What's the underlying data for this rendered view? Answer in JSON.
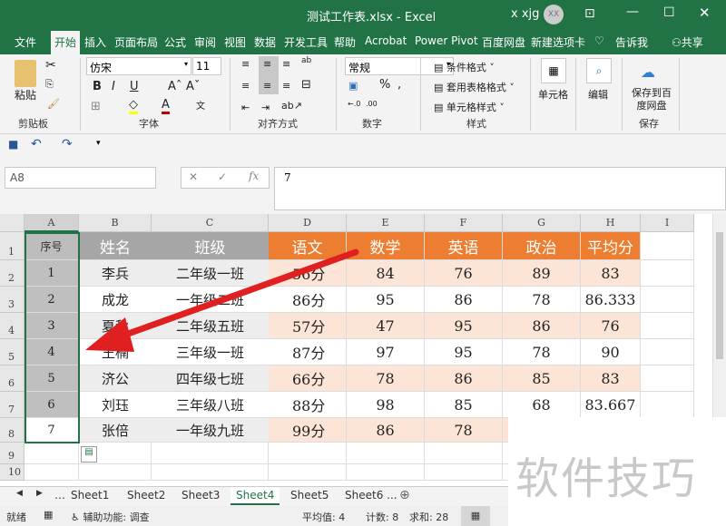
{
  "window": {
    "title": "测试工作表.xlsx  -  Excel",
    "user": "x xjg",
    "avatar": "XX"
  },
  "ribbon_tabs": [
    "文件",
    "开始",
    "插入",
    "页面布局",
    "公式",
    "审阅",
    "视图",
    "数据",
    "开发工具",
    "帮助",
    "Acrobat",
    "Power Pivot",
    "百度网盘",
    "新建选项卡",
    "告诉我",
    "共享"
  ],
  "ribbon": {
    "paste": "粘贴",
    "font_name": "仿宋",
    "font_size": "11",
    "number_format": "常规",
    "cond_format": "条件格式",
    "table_format": "套用表格格式",
    "cell_style": "单元格样式",
    "cells": "单元格",
    "edit": "编辑",
    "save_baidu": "保存到百度网盘",
    "groups": [
      "剪贴板",
      "字体",
      "对齐方式",
      "数字",
      "样式",
      "保存"
    ]
  },
  "formula_bar": {
    "name_box": "A8",
    "fx": "fx",
    "value": "7"
  },
  "columns": [
    "A",
    "B",
    "C",
    "D",
    "E",
    "F",
    "G",
    "H",
    "I"
  ],
  "rows": [
    "1",
    "2",
    "3",
    "4",
    "5",
    "6",
    "7",
    "8",
    "9",
    "10"
  ],
  "table": {
    "headers": [
      "序号",
      "姓名",
      "班级",
      "语文",
      "数学",
      "英语",
      "政治",
      "平均分"
    ],
    "data": [
      [
        "1",
        "李兵",
        "二年级一班",
        "56分",
        "84",
        "76",
        "89",
        "83"
      ],
      [
        "2",
        "成龙",
        "一年级二班",
        "86分",
        "95",
        "86",
        "78",
        "86.333"
      ],
      [
        "3",
        "夏秋",
        "二年级五班",
        "57分",
        "47",
        "95",
        "86",
        "76"
      ],
      [
        "4",
        "王楠",
        "三年级一班",
        "87分",
        "97",
        "95",
        "78",
        "90"
      ],
      [
        "5",
        "济公",
        "四年级七班",
        "66分",
        "78",
        "86",
        "85",
        "83"
      ],
      [
        "6",
        "刘珏",
        "三年级八班",
        "88分",
        "98",
        "85",
        "68",
        "83.667"
      ],
      [
        "7",
        "张倍",
        "一年级九班",
        "99分",
        "86",
        "78",
        "",
        ""
      ]
    ]
  },
  "sheets": [
    "Sheet1",
    "Sheet2",
    "Sheet3",
    "Sheet4",
    "Sheet5",
    "Sheet6 ..."
  ],
  "active_sheet": "Sheet4",
  "status": {
    "ready": "就绪",
    "accessibility": "辅助功能: 调查",
    "average": "平均值: 4",
    "count": "计数: 8",
    "sum": "求和: 28"
  },
  "watermark": "软件技巧",
  "colors": {
    "green": "#217346",
    "orange": "#ed7d31",
    "light_orange": "#fce4d6",
    "gray_header": "#a6a6a6",
    "arrow": "#e02020"
  }
}
